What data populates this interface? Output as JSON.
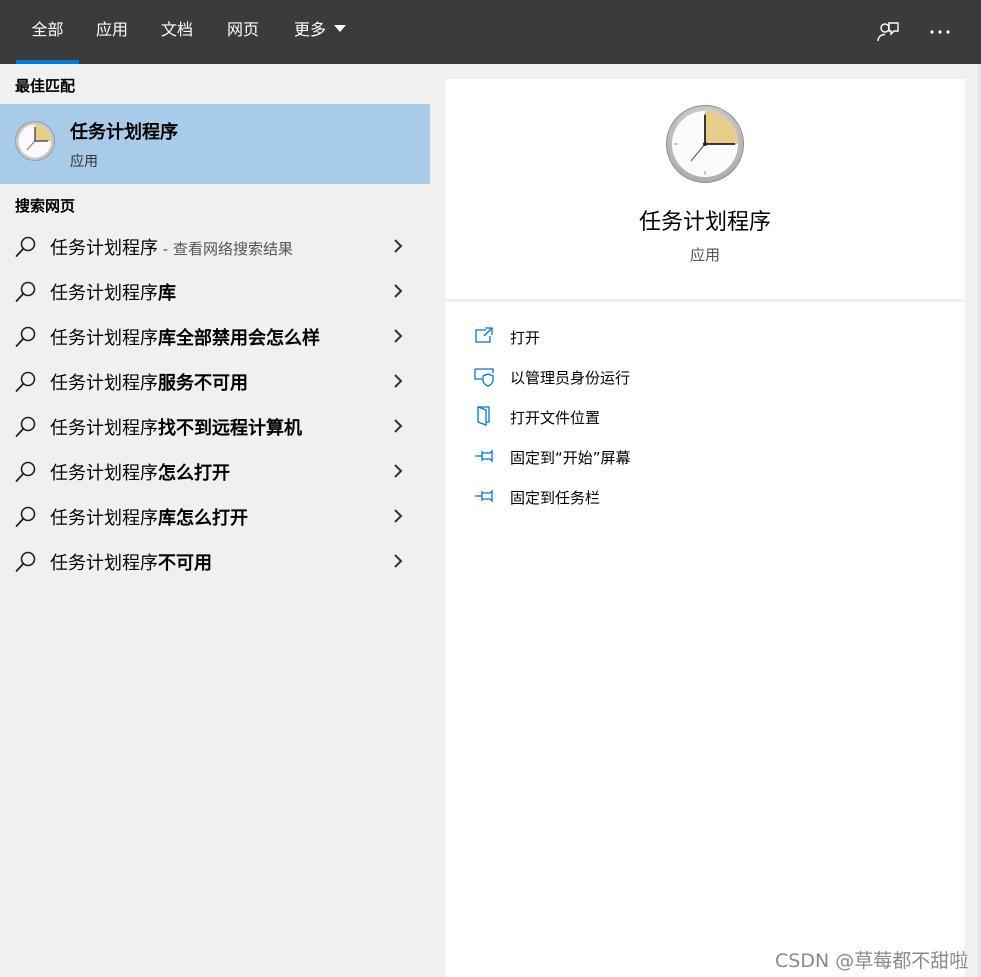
{
  "tabs": [
    {
      "label": "全部"
    },
    {
      "label": "应用"
    },
    {
      "label": "文档"
    },
    {
      "label": "网页"
    },
    {
      "label": "更多"
    }
  ],
  "topbar_icons": [
    "feedback-icon",
    "more-options-icon"
  ],
  "left": {
    "best_match_title": "最佳匹配",
    "best_match": {
      "name": "任务计划程序",
      "type": "应用",
      "icon": "clock-icon"
    },
    "web_title": "搜索网页",
    "web_results": [
      {
        "prefix": "任务计划程序",
        "suffix": "",
        "hint": " - 查看网络搜索结果"
      },
      {
        "prefix": "任务计划程序",
        "suffix": "库",
        "hint": ""
      },
      {
        "prefix": "任务计划程序",
        "suffix": "库全部禁用会怎么样",
        "hint": ""
      },
      {
        "prefix": "任务计划程序",
        "suffix": "服务不可用",
        "hint": ""
      },
      {
        "prefix": "任务计划程序",
        "suffix": "找不到远程计算机",
        "hint": ""
      },
      {
        "prefix": "任务计划程序",
        "suffix": "怎么打开",
        "hint": ""
      },
      {
        "prefix": "任务计划程序",
        "suffix": "库怎么打开",
        "hint": ""
      },
      {
        "prefix": "任务计划程序",
        "suffix": "不可用",
        "hint": ""
      }
    ]
  },
  "right": {
    "title": "任务计划程序",
    "type": "应用",
    "actions": [
      {
        "label": "打开",
        "icon": "open-icon"
      },
      {
        "label": "以管理员身份运行",
        "icon": "shield-icon"
      },
      {
        "label": "打开文件位置",
        "icon": "file-location-icon"
      },
      {
        "label": "固定到“开始”屏幕",
        "icon": "pin-icon"
      },
      {
        "label": "固定到任务栏",
        "icon": "pin-icon"
      }
    ]
  },
  "watermark": "CSDN @草莓都不甜啦",
  "colors": {
    "topbar": "#3b3b3b",
    "accent": "#0078d7",
    "selected": "#a8cbea",
    "pane": "#f0f0f0"
  }
}
